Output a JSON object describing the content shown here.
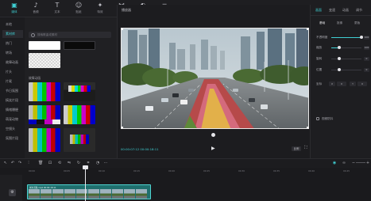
{
  "toolbar": {
    "items": [
      {
        "label": "媒体",
        "icon": "media-icon"
      },
      {
        "label": "音频",
        "icon": "audio-icon"
      },
      {
        "label": "文本",
        "icon": "text-icon"
      },
      {
        "label": "贴纸",
        "icon": "sticker-icon"
      },
      {
        "label": "特效",
        "icon": "effects-icon"
      },
      {
        "label": "转场",
        "icon": "transition-icon"
      },
      {
        "label": "滤镜",
        "icon": "filter-icon"
      },
      {
        "label": "调节",
        "icon": "adjust-icon"
      }
    ],
    "active_index": 0
  },
  "left_nav": {
    "items": [
      "本地",
      "素材库",
      "热门",
      "转场",
      "故障动画",
      "片头",
      "片尾",
      "节日氛围",
      "搞笑片段",
      "情绪爆梗",
      "萌宠动物",
      "空镜头",
      "氛围片段"
    ],
    "active_index": 1
  },
  "media": {
    "search_placeholder": "搜索歌曲或素材",
    "section_title": "故障动画"
  },
  "player": {
    "title": "播放器",
    "timecode": "00:00:07:12  00:00:18:11",
    "ratio_label": "比例"
  },
  "properties": {
    "tabs": [
      "画面",
      "变速",
      "动画",
      "调节"
    ],
    "active_tab": 0,
    "subtabs": [
      "基础",
      "抠像",
      "蒙版"
    ],
    "active_subtab": 0,
    "rows": [
      {
        "label": "不透明度",
        "value": "100"
      },
      {
        "label": "缩放",
        "value": "100"
      },
      {
        "label": "旋转",
        "value": "0"
      },
      {
        "label": "位置",
        "value": "0"
      }
    ],
    "position_label": "坐标",
    "x_label": "X",
    "y_label": "Y",
    "x_value": "0",
    "y_value": "0",
    "checkbox_label": "视频防抖"
  },
  "timeline": {
    "ruler": [
      "00:00",
      "00:05",
      "00:10",
      "00:15",
      "00:20",
      "00:25",
      "00:30",
      "00:35",
      "00:40",
      "00:45"
    ],
    "clip_label": "城市道路.mp4  00:00:18:11",
    "cover_label": "封面"
  },
  "colors": {
    "accent": "#3fd0d4",
    "clip_fill": "#1f6f6e",
    "panel_bg": "#202023"
  }
}
